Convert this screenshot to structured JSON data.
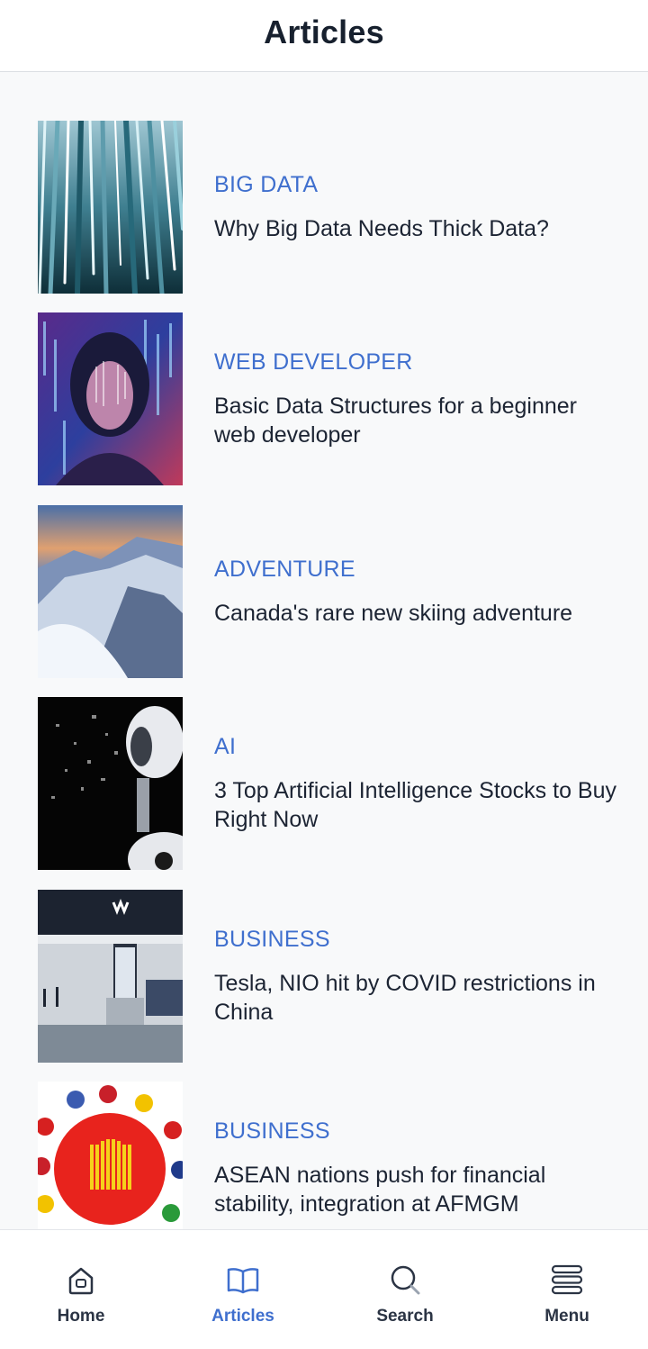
{
  "header": {
    "title": "Articles"
  },
  "articles": [
    {
      "category": "BIG DATA",
      "title": "Why Big Data Needs Thick Data?"
    },
    {
      "category": "WEB DEVELOPER",
      "title": "Basic Data Structures for a beginner web developer"
    },
    {
      "category": "ADVENTURE",
      "title": "Canada's rare new skiing adventure"
    },
    {
      "category": "AI",
      "title": "3 Top Artificial Intelligence Stocks to Buy Right Now"
    },
    {
      "category": "BUSINESS",
      "title": "Tesla, NIO hit by COVID restrictions in China"
    },
    {
      "category": "BUSINESS",
      "title": "ASEAN nations push for financial stability, integration at AFMGM"
    }
  ],
  "tabbar": {
    "home": "Home",
    "articles": "Articles",
    "search": "Search",
    "menu": "Menu"
  },
  "colors": {
    "accent": "#3f6fce",
    "text": "#1c2433",
    "background": "#f8f9fa"
  },
  "icons": {
    "home": "home-icon",
    "articles": "book-icon",
    "search": "search-icon",
    "menu": "menu-icon"
  }
}
